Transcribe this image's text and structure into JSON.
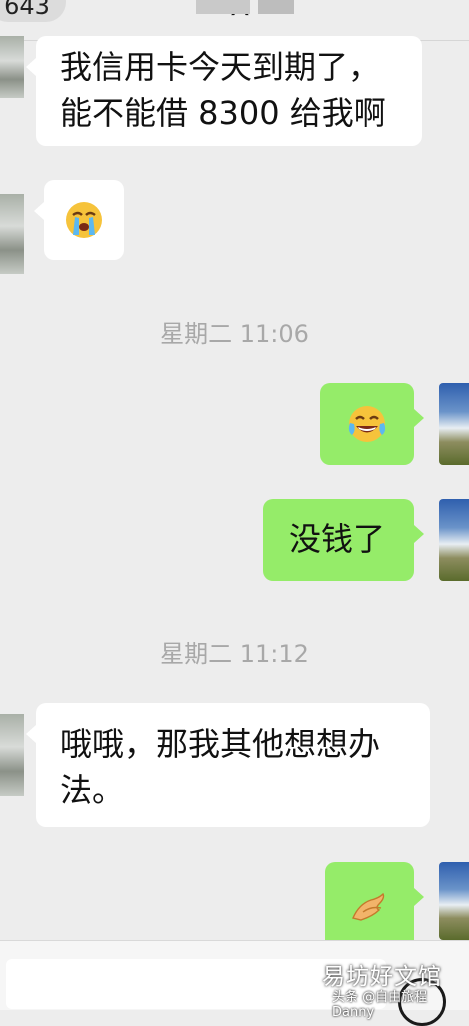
{
  "header": {
    "unread_count": "643",
    "contact_name": "X"
  },
  "messages": [
    {
      "side": "in",
      "type": "text",
      "lines": [
        "我信用卡今天到期了，",
        "能不能借 8300 给我啊"
      ]
    },
    {
      "side": "in",
      "type": "emoji",
      "icon": "loudly-crying-face"
    },
    {
      "type": "time",
      "text": "星期二 11:06"
    },
    {
      "side": "out",
      "type": "emoji",
      "icon": "face-with-tears-of-joy"
    },
    {
      "side": "out",
      "type": "text",
      "lines": [
        "没钱了"
      ]
    },
    {
      "type": "time",
      "text": "星期二 11:12"
    },
    {
      "side": "in",
      "type": "text",
      "lines": [
        "哦哦，那我其他想想办",
        "法。"
      ]
    },
    {
      "side": "out",
      "type": "emoji",
      "icon": "pinching-hand"
    }
  ],
  "watermark": {
    "title": "易坊好文馆",
    "subtitle": "头条 @自由旅程Danny"
  },
  "colors": {
    "background": "#ededed",
    "bubble_out": "#95ec69",
    "bubble_in": "#ffffff",
    "timestamp": "#a8a8a8"
  }
}
